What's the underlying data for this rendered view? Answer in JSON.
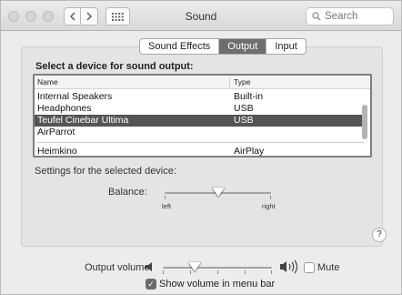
{
  "window": {
    "title": "Sound",
    "search_placeholder": "Search"
  },
  "icons": {
    "back": "chevron-left-icon",
    "forward": "chevron-right-icon",
    "grid": "grid-icon",
    "search": "search-icon",
    "volume_low": "speaker-icon",
    "volume_high": "speaker-waves-icon"
  },
  "tabs": [
    {
      "label": "Sound Effects",
      "active": false
    },
    {
      "label": "Output",
      "active": true
    },
    {
      "label": "Input",
      "active": false
    }
  ],
  "output": {
    "section_title": "Select a device for sound output:",
    "columns": [
      "Name",
      "Type"
    ],
    "devices": [
      {
        "name": "Internal Speakers",
        "type": "Built-in"
      },
      {
        "name": "Headphones",
        "type": "USB"
      },
      {
        "name": "Teufel Cinebar Ultima",
        "type": "USB",
        "selected": true
      },
      {
        "name": "AirParrot",
        "type": ""
      },
      {
        "name": "Heimkino",
        "type": "AirPlay"
      }
    ],
    "settings_label": "Settings for the selected device:",
    "balance": {
      "label": "Balance:",
      "left_label": "left",
      "right_label": "right",
      "value": 0.5
    },
    "help": "?"
  },
  "volume": {
    "label": "Output volume:",
    "value": 0.3,
    "mute_label": "Mute",
    "mute_checked": false,
    "show_in_menu_bar_label": "Show volume in menu bar",
    "show_in_menu_bar_checked": true
  }
}
